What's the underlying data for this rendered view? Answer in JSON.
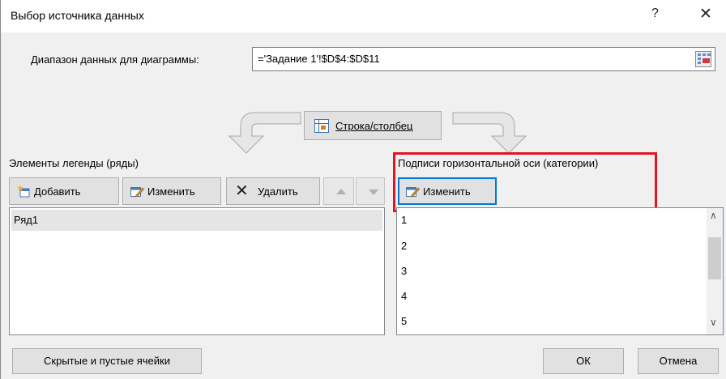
{
  "window": {
    "title": "Выбор источника данных",
    "help": "?",
    "close": "✕"
  },
  "range": {
    "label": "Диапазон данных для диаграммы:",
    "value": "='Задание 1'!$D$4:$D$11"
  },
  "switch_button": {
    "label": "Строка/столбец"
  },
  "legend": {
    "title": "Элементы легенды (ряды)",
    "add_label": "Добавить",
    "edit_label": "Изменить",
    "delete_label": "Удалить",
    "items": [
      "Ряд1"
    ]
  },
  "axis": {
    "title": "Подписи горизонтальной оси (категории)",
    "edit_label": "Изменить",
    "items": [
      "1",
      "2",
      "3",
      "4",
      "5"
    ]
  },
  "footer": {
    "hidden_cells_label": "Скрытые и пустые ячейки",
    "ok_label": "ОК",
    "cancel_label": "Отмена"
  },
  "colors": {
    "highlight_red": "#e3141e",
    "focus_blue": "#0078d7",
    "dialog_bg": "#f0f0f0"
  }
}
